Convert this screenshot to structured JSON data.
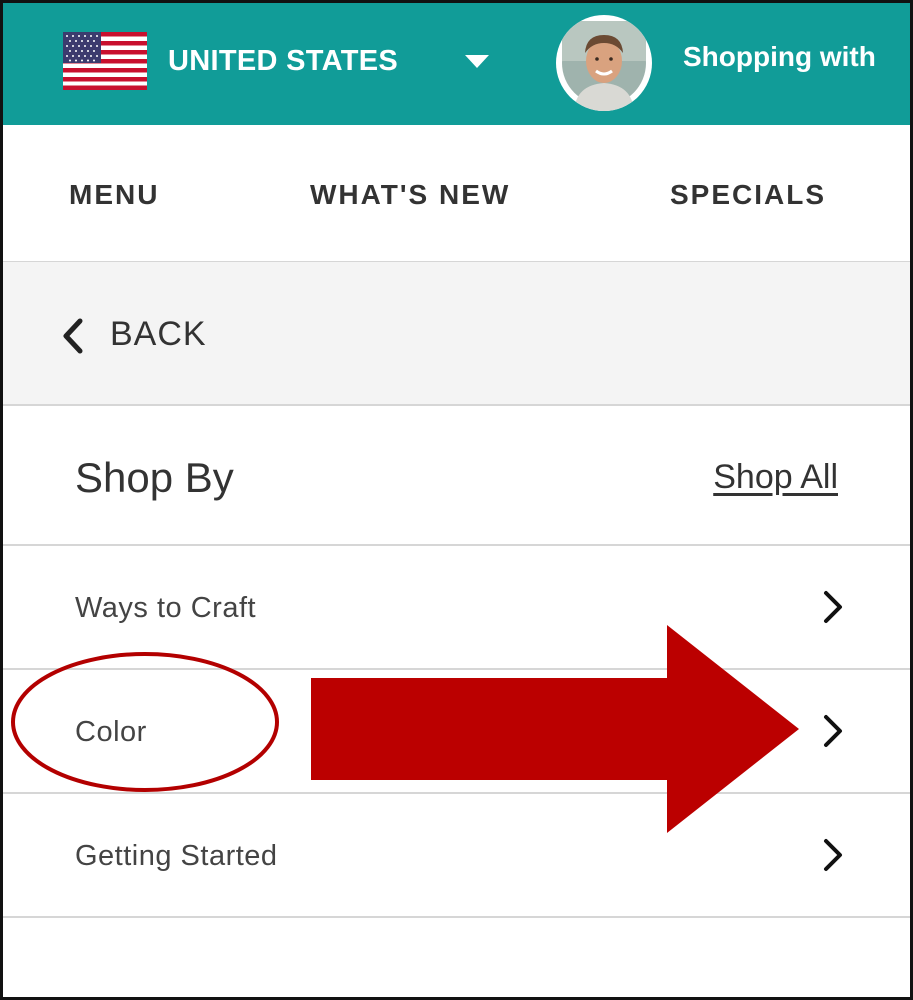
{
  "header": {
    "country_label": "UNITED STATES",
    "shopping_with_label": "Shopping with",
    "flag_icon": "us-flag-icon",
    "dropdown_icon": "caret-down-icon",
    "avatar_icon": "demonstrator-avatar",
    "bar_color": "#119c98"
  },
  "nav": {
    "menu_label": "MENU",
    "whats_new_label": "WHAT'S NEW",
    "specials_label": "SPECIALS"
  },
  "back": {
    "label": "BACK",
    "icon": "chevron-left-icon"
  },
  "shop_by": {
    "title": "Shop By",
    "shop_all_label": "Shop All"
  },
  "list": {
    "items": [
      {
        "label": "Ways to Craft",
        "icon": "chevron-right-icon"
      },
      {
        "label": "Color",
        "icon": "chevron-right-icon"
      },
      {
        "label": "Getting Started",
        "icon": "chevron-right-icon"
      }
    ]
  },
  "annotations": {
    "color": "#c00000",
    "circle_target": "Color",
    "arrow_points_to": "Color chevron"
  }
}
